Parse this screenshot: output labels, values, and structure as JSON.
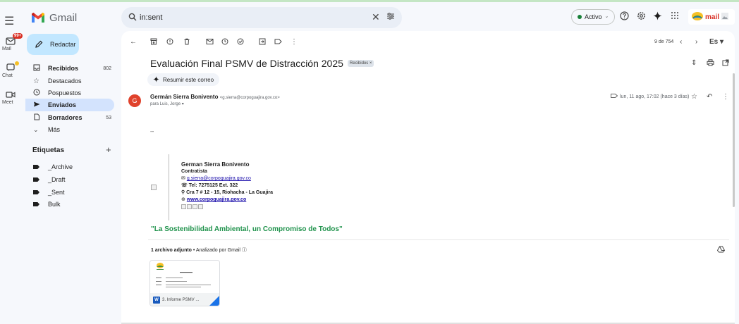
{
  "app": {
    "title": "Gmail"
  },
  "rail": {
    "badge": "99+",
    "items": [
      {
        "label": "Mail"
      },
      {
        "label": "Chat"
      },
      {
        "label": "Meet"
      }
    ]
  },
  "search": {
    "query": "in:sent"
  },
  "header": {
    "status": "Activo",
    "account_logo_text": "mail"
  },
  "sidebar": {
    "compose": "Redactar",
    "items": [
      {
        "label": "Recibidos",
        "count": "802",
        "icon": "inbox-icon"
      },
      {
        "label": "Destacados",
        "count": "",
        "icon": "star-icon"
      },
      {
        "label": "Pospuestos",
        "count": "",
        "icon": "clock-icon"
      },
      {
        "label": "Enviados",
        "count": "",
        "icon": "send-icon"
      },
      {
        "label": "Borradores",
        "count": "53",
        "icon": "draft-icon"
      },
      {
        "label": "Más",
        "count": "",
        "icon": "chevron-down-icon"
      }
    ],
    "labels_title": "Etiquetas",
    "labels": [
      "_Archive",
      "_Draft",
      "_Sent",
      "Bulk"
    ]
  },
  "toolbar": {
    "counter": "9 de 754",
    "lang": "Es"
  },
  "email": {
    "subject": "Evaluación Final PSMV de Distracción 2025",
    "subject_chip": "Recibidos ×",
    "summarize": "Resumir este correo",
    "avatar_letter": "G",
    "sender_name": "Germán Sierra Bonivento",
    "sender_email": "<g.sierra@corpoguajira.gov.co>",
    "recipients": "para Luis, Jorge",
    "date": "lun, 11 ago, 17:02 (hace 3 días)",
    "dash": "--",
    "signature": {
      "name": "German Sierra Bonivento",
      "role": "Contratista",
      "email": "g.sierra@corpoguajira.gov.co",
      "phone": "Tel: 7275125 Ext. 322",
      "address": "Cra 7 # 12 - 15, Riohacha - La Guajira",
      "website": "www.corpoguajira.gov.co"
    },
    "slogan": "\"La Sostenibilidad Ambiental, un Compromiso de Todos\"",
    "attachments_header": "1 archivo adjunto",
    "attachments_analyzed": "• Analizado por Gmail ⓘ",
    "attachment_name": "3. Informe PSMV ..."
  }
}
